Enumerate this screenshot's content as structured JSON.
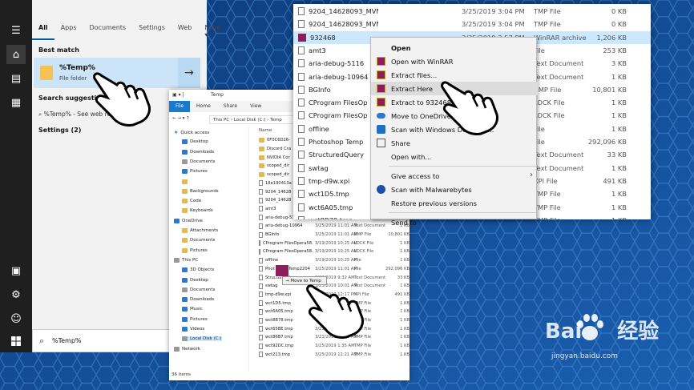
{
  "start_menu": {
    "tabs": [
      "All",
      "Apps",
      "Documents",
      "Settings",
      "Web",
      "More ▾"
    ],
    "selected_tab": "All",
    "best_match_header": "Best match",
    "best_match": {
      "name": "%Temp%",
      "type": "File folder"
    },
    "search_suggestions_header": "Search suggestions",
    "suggestion": "%Temp% - See web results",
    "settings_header": "Settings (2)",
    "search_value": "%Temp%"
  },
  "explorer": {
    "title": "Temp",
    "ribbon": [
      "File",
      "Home",
      "Share",
      "View"
    ],
    "breadcrumb": [
      "This PC",
      "Local Disk (C:)",
      "Temp"
    ],
    "column_name": "Name",
    "nav": [
      {
        "label": "Quick access",
        "kind": "star"
      },
      {
        "label": "Desktop",
        "kind": "blue"
      },
      {
        "label": "Downloads",
        "kind": "blue"
      },
      {
        "label": "Documents",
        "kind": "gray"
      },
      {
        "label": "Pictures",
        "kind": "blue"
      },
      {
        "label": "",
        "kind": "folder"
      },
      {
        "label": "Backgrounds",
        "kind": "folder"
      },
      {
        "label": "Code",
        "kind": "folder"
      },
      {
        "label": "Keyboards",
        "kind": "folder"
      },
      {
        "label": "OneDrive",
        "kind": "cloud"
      },
      {
        "label": "Attachments",
        "kind": "folder"
      },
      {
        "label": "Documents",
        "kind": "folder"
      },
      {
        "label": "Pictures",
        "kind": "folder"
      },
      {
        "label": "This PC",
        "kind": "pc"
      },
      {
        "label": "3D Objects",
        "kind": "blue"
      },
      {
        "label": "Desktop",
        "kind": "blue"
      },
      {
        "label": "Documents",
        "kind": "gray"
      },
      {
        "label": "Downloads",
        "kind": "blue"
      },
      {
        "label": "Music",
        "kind": "blue"
      },
      {
        "label": "Pictures",
        "kind": "blue"
      },
      {
        "label": "Videos",
        "kind": "blue"
      },
      {
        "label": "Local Disk (C:)",
        "kind": "gray"
      },
      {
        "label": "Network",
        "kind": "gray"
      }
    ],
    "files": [
      {
        "name": "0F0C6D26-",
        "date": "",
        "type": "",
        "size": "",
        "kind": "folder"
      },
      {
        "name": "Discord Cra",
        "date": "",
        "type": "",
        "size": "",
        "kind": "folder"
      },
      {
        "name": "NVIDIA Cor",
        "date": "",
        "type": "",
        "size": "",
        "kind": "folder"
      },
      {
        "name": "scoped_dir",
        "date": "",
        "type": "",
        "size": "",
        "kind": "folder"
      },
      {
        "name": "scoped_dir",
        "date": "",
        "type": "",
        "size": "",
        "kind": "folder"
      },
      {
        "name": "18e190413a",
        "date": "",
        "type": "",
        "size": "",
        "kind": "doc"
      },
      {
        "name": "9204_14628",
        "date": "",
        "type": "",
        "size": "",
        "kind": "doc"
      },
      {
        "name": "9204_14628",
        "date": "",
        "type": "",
        "size": "",
        "kind": "doc"
      },
      {
        "name": "amt3",
        "date": "",
        "type": "",
        "size": "",
        "kind": "doc"
      },
      {
        "name": "aria-debug-5116",
        "date": "3/25/2019 11:01 AM",
        "type": "Text Document",
        "size": "3 KB",
        "kind": "doc"
      },
      {
        "name": "aria-debug-10964",
        "date": "3/25/2019 11:01 AM",
        "type": "Text Document",
        "size": "1 KB",
        "kind": "doc"
      },
      {
        "name": "BGInfo",
        "date": "3/25/2019 11:01 AM",
        "type": "BMP File",
        "size": "10,801 KB",
        "kind": "doc"
      },
      {
        "name": "CProgram FilesOpera58.0.3135.79opera_a...",
        "date": "3/19/2019 10:25 AM",
        "type": "LOCK File",
        "size": "1 KB",
        "kind": "doc"
      },
      {
        "name": "CProgram FilesOpera58.0.3135.79opera_a...",
        "date": "3/19/2019 10:25 AM",
        "type": "LOCK File",
        "size": "1 KB",
        "kind": "doc"
      },
      {
        "name": "offline",
        "date": "3/19/2019 10:25 AM",
        "type": "File",
        "size": "1 KB",
        "kind": "doc"
      },
      {
        "name": "Photoshop Temp2204",
        "date": "3/25/2019 11:01 AM",
        "type": "File",
        "size": "292,096 KB",
        "kind": "doc"
      },
      {
        "name": "StructuredQuery",
        "date": "3/22/2019 9:32 AM",
        "type": "Text Document",
        "size": "33 KB",
        "kind": "doc"
      },
      {
        "name": "swtag",
        "date": "3/25/2019 10:01 AM",
        "type": "Text Document",
        "size": "1 KB",
        "kind": "doc"
      },
      {
        "name": "tmp-d9w.xpi",
        "date": "3/19/2019 12:17 PM",
        "type": "XPI File",
        "size": "491 KB",
        "kind": "doc"
      },
      {
        "name": "wct1D5.tmp",
        "date": "3/19/2019 12:22 AM",
        "type": "TMP File",
        "size": "1 KB",
        "kind": "doc"
      },
      {
        "name": "wct6A05.tmp",
        "date": "3/23/2019 1:25 AM",
        "type": "TMP File",
        "size": "1 KB",
        "kind": "doc"
      },
      {
        "name": "wct8B78.tmp",
        "date": "3/23/2019 12:37 AM",
        "type": "TMP File",
        "size": "1 KB",
        "kind": "doc"
      },
      {
        "name": "wct65BE.tmp",
        "date": "3/21/2019 2:17 AM",
        "type": "TMP File",
        "size": "1 KB",
        "kind": "doc"
      },
      {
        "name": "wct86B7.tmp",
        "date": "3/21/2019 12:46 AM",
        "type": "TMP File",
        "size": "1 KB",
        "kind": "doc"
      },
      {
        "name": "wct92DC.tmp",
        "date": "3/25/2019 1:35 AM",
        "type": "TMP File",
        "size": "1 KB",
        "kind": "doc"
      },
      {
        "name": "wct213.tmp",
        "date": "3/25/2019 12:21 AM",
        "type": "TMP File",
        "size": "1 KB",
        "kind": "doc"
      }
    ],
    "status": "36 items",
    "drag_tip": "Move to Temp"
  },
  "window": {
    "rows": [
      {
        "name": "9204_14628093_MVM_0.tmp",
        "date": "3/25/2019 3:04 PM",
        "type": "TMP File",
        "size": "0 KB",
        "kind": "doc",
        "selected": false
      },
      {
        "name": "9204_14628093_MVM_1.tmp",
        "date": "3/25/2019 3:04 PM",
        "type": "TMP File",
        "size": "0 KB",
        "kind": "doc",
        "selected": false
      },
      {
        "name": "932468",
        "date": "3/25/2019 3:57 PM",
        "type": "WinRAR archive",
        "size": "1,206 KB",
        "kind": "rar",
        "selected": true
      },
      {
        "name": "amt3",
        "date": "",
        "type": "File",
        "size": "253 KB",
        "kind": "doc",
        "selected": false
      },
      {
        "name": "aria-debug-5116",
        "date": "",
        "type": "Text Document",
        "size": "3 KB",
        "kind": "doc",
        "selected": false
      },
      {
        "name": "aria-debug-10964",
        "date": "",
        "type": "Text Document",
        "size": "1 KB",
        "kind": "doc",
        "selected": false
      },
      {
        "name": "BGInfo",
        "date": "",
        "type": "BMP File",
        "size": "10,801 KB",
        "kind": "doc",
        "selected": false
      },
      {
        "name": "CProgram FilesOp",
        "date": "",
        "type": "LOCK File",
        "size": "1 KB",
        "kind": "doc",
        "selected": false
      },
      {
        "name": "CProgram FilesOp",
        "date": "",
        "type": "LOCK File",
        "size": "1 KB",
        "kind": "doc",
        "selected": false
      },
      {
        "name": "offline",
        "date": "",
        "type": "File",
        "size": "1 KB",
        "kind": "doc",
        "selected": false
      },
      {
        "name": "Photoshop Temp",
        "date": "",
        "type": "File",
        "size": "292,096 KB",
        "kind": "doc",
        "selected": false
      },
      {
        "name": "StructuredQuery",
        "date": "",
        "type": "Text Document",
        "size": "33 KB",
        "kind": "doc",
        "selected": false
      },
      {
        "name": "swtag",
        "date": "",
        "type": "Text Document",
        "size": "1 KB",
        "kind": "doc",
        "selected": false
      },
      {
        "name": "tmp-d9w.xpi",
        "date": "",
        "type": "XPI File",
        "size": "491 KB",
        "kind": "doc",
        "selected": false
      },
      {
        "name": "wct1D5.tmp",
        "date": "",
        "type": "TMP File",
        "size": "1 KB",
        "kind": "doc",
        "selected": false
      },
      {
        "name": "wct6A05.tmp",
        "date": "",
        "type": "TMP File",
        "size": "1 KB",
        "kind": "doc",
        "selected": false
      },
      {
        "name": "wct8B78.tmp",
        "date": "",
        "type": "TMP File",
        "size": "1 KB",
        "kind": "doc",
        "selected": false
      }
    ]
  },
  "context_menu": {
    "items": [
      {
        "label": "Open",
        "icon": "",
        "bold": true,
        "top": 0
      },
      {
        "label": "Open with WinRAR",
        "icon": "winrar-icon"
      },
      {
        "label": "Extract files...",
        "icon": "winrar-icon"
      },
      {
        "label": "Extract Here",
        "icon": "winrar-icon",
        "highlighted": true
      },
      {
        "label": "Extract to 932468\\",
        "icon": "winrar-icon"
      },
      {
        "label": "Move to OneDrive",
        "icon": "onedrive-icon"
      },
      {
        "label": "Scan with Windows Defender...",
        "icon": "defender-icon"
      },
      {
        "label": "Share",
        "icon": "share-icon"
      },
      {
        "label": "Open with...",
        "icon": ""
      },
      {
        "label": "Give access to",
        "icon": "",
        "submenu": true,
        "sep_before": true
      },
      {
        "label": "Scan with Malwarebytes",
        "icon": "malwarebytes-icon"
      },
      {
        "label": "Restore previous versions",
        "icon": ""
      },
      {
        "label": "Send to",
        "icon": "",
        "submenu": true,
        "sep_before": true
      }
    ]
  },
  "watermark": {
    "brand": "Bai",
    "brand2": "经验",
    "url": "jingyan.baidu.com"
  }
}
